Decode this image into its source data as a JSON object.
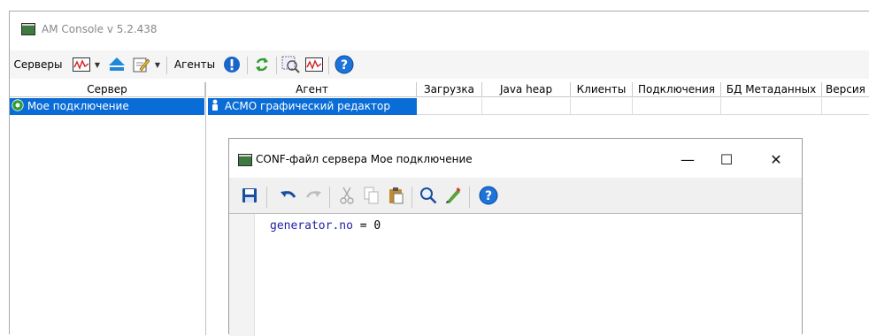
{
  "window": {
    "title": "AM Console v  5.2.438"
  },
  "toolbar": {
    "servers_label": "Серверы",
    "agents_label": "Агенты"
  },
  "left_table": {
    "header": "Сервер",
    "rows": [
      "Мое подключение"
    ]
  },
  "right_table": {
    "headers": [
      "Агент",
      "Загрузка",
      "Java heap",
      "Клиенты",
      "Подключения",
      "БД Метаданных",
      "Версия"
    ],
    "rows": [
      [
        "АСМО графический редактор",
        "",
        "",
        "",
        "",
        "",
        ""
      ]
    ]
  },
  "dialog": {
    "title": "CONF-файл сервера Мое подключение",
    "minimize": "—",
    "maximize": "☐",
    "close": "✕",
    "editor": {
      "key": "generator.no",
      "op": " = ",
      "value": "0"
    }
  },
  "colors": {
    "selection": "#0a6cd6",
    "help_icon": "#1e73d8",
    "refresh_icon": "#2e9c2e",
    "alert_icon": "#1a65c8",
    "save_icon": "#1b4e9b"
  }
}
